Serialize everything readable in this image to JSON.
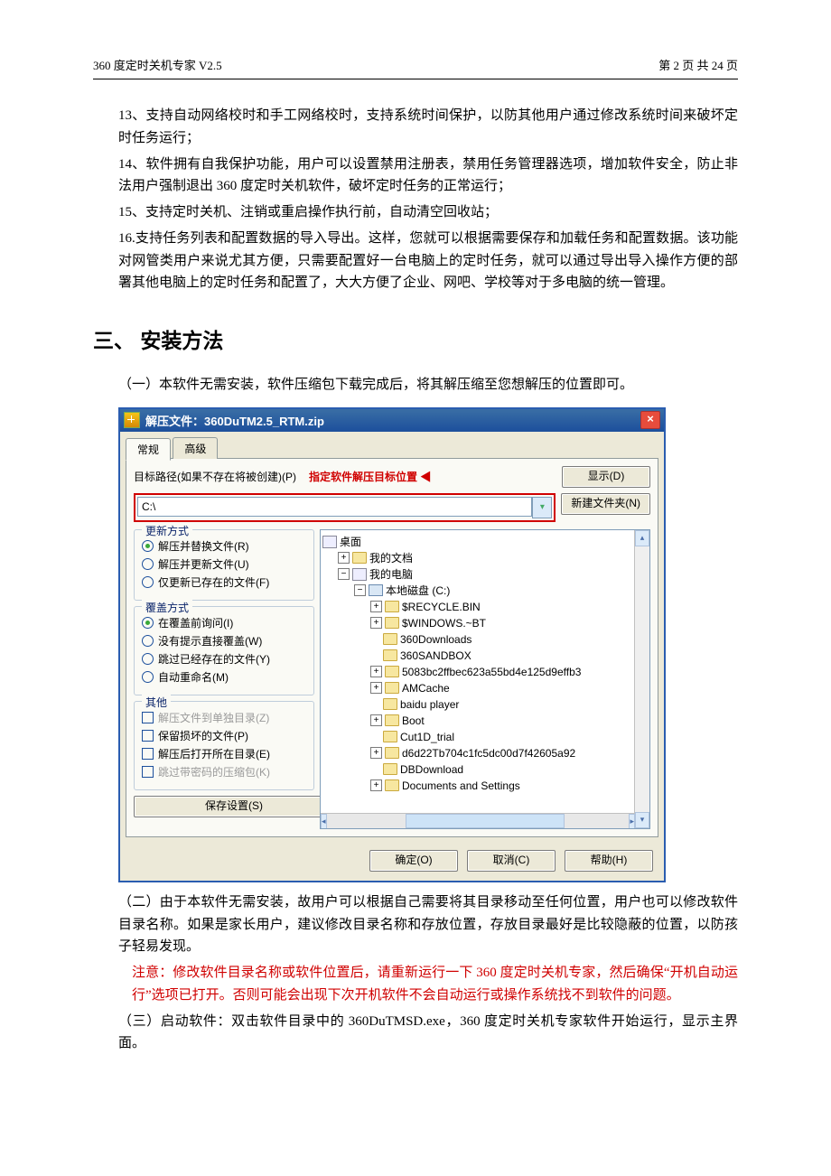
{
  "header": {
    "left": "360 度定时关机专家  V2.5",
    "right": "第 2 页 共 24 页"
  },
  "paragraphs": {
    "p13": "13、支持自动网络校时和手工网络校时，支持系统时间保护，以防其他用户通过修改系统时间来破坏定时任务运行；",
    "p14": "14、软件拥有自我保护功能，用户可以设置禁用注册表，禁用任务管理器选项，增加软件安全，防止非法用户强制退出 360 度定时关机软件，破坏定时任务的正常运行；",
    "p15": "15、支持定时关机、注销或重启操作执行前，自动清空回收站；",
    "p16": "16.支持任务列表和配置数据的导入导出。这样，您就可以根据需要保存和加载任务和配置数据。该功能对网管类用户来说尤其方便，只需要配置好一台电脑上的定时任务，就可以通过导出导入操作方便的部署其他电脑上的定时任务和配置了，大大方便了企业、网吧、学校等对于多电脑的统一管理。"
  },
  "h2": "三、 安装方法",
  "step1": "（一）本软件无需安装，软件压缩包下载完成后，将其解压缩至您想解压的位置即可。",
  "dialog": {
    "title": "解压文件：360DuTM2.5_RTM.zip",
    "tabs": {
      "general": "常规",
      "advanced": "高级"
    },
    "pathLabel": "目标路径(如果不存在将被创建)(P)",
    "annotation": "指定软件解压目标位置",
    "btnShow": "显示(D)",
    "btnNewFolder": "新建文件夹(N)",
    "pathValue": "C:\\",
    "groups": {
      "update": {
        "title": "更新方式",
        "r1": "解压并替换文件(R)",
        "r2": "解压并更新文件(U)",
        "r3": "仅更新已存在的文件(F)"
      },
      "overwrite": {
        "title": "覆盖方式",
        "r1": "在覆盖前询问(I)",
        "r2": "没有提示直接覆盖(W)",
        "r3": "跳过已经存在的文件(Y)",
        "r4": "自动重命名(M)"
      },
      "other": {
        "title": "其他",
        "c1": "解压文件到单独目录(Z)",
        "c2": "保留损坏的文件(P)",
        "c3": "解压后打开所在目录(E)",
        "c4": "跳过带密码的压缩包(K)"
      }
    },
    "saveSettings": "保存设置(S)",
    "tree": {
      "desktop": "桌面",
      "mydocs": "我的文档",
      "mypc": "我的电脑",
      "drive": "本地磁盘 (C:)",
      "items": [
        "$RECYCLE.BIN",
        "$WINDOWS.~BT",
        "360Downloads",
        "360SANDBOX",
        "5083bc2ffbec623a55bd4e125d9effb3",
        "AMCache",
        "baidu player",
        "Boot",
        "Cut1D_trial",
        "d6d22Tb704c1fc5dc00d7f42605a92",
        "DBDownload",
        "Documents and Settings"
      ]
    },
    "btnOk": "确定(O)",
    "btnCancel": "取消(C)",
    "btnHelp": "帮助(H)"
  },
  "step2": "（二）由于本软件无需安装，故用户可以根据自己需要将其目录移动至任何位置，用户也可以修改软件目录名称。如果是家长用户，建议修改目录名称和存放位置，存放目录最好是比较隐蔽的位置，以防孩子轻易发现。",
  "note": "注意：修改软件目录名称或软件位置后，请重新运行一下 360 度定时关机专家，然后确保“开机自动运行”选项已打开。否则可能会出现下次开机软件不会自动运行或操作系统找不到软件的问题。",
  "step3": "（三）启动软件：双击软件目录中的 360DuTMSD.exe，360 度定时关机专家软件开始运行，显示主界面。"
}
